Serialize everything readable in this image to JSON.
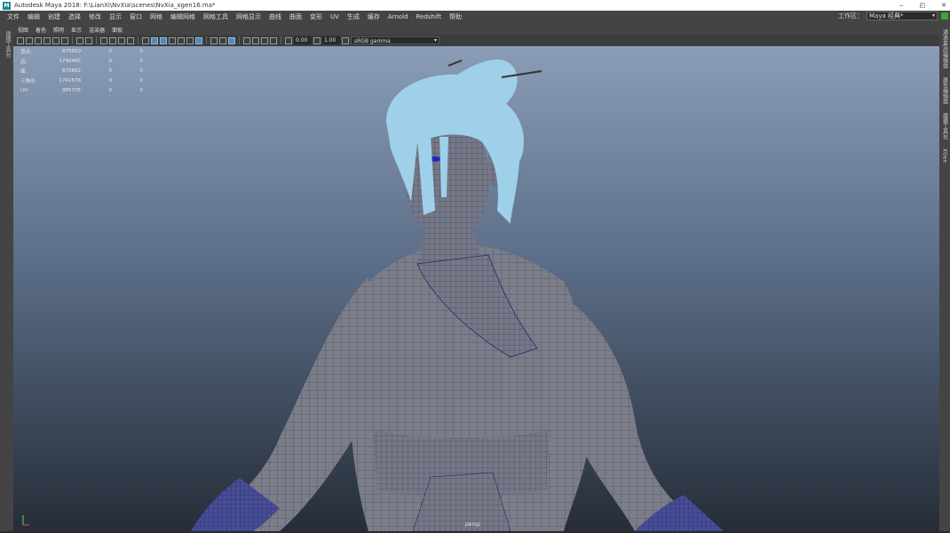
{
  "window": {
    "title": "Autodesk Maya 2018: F:\\LianXi\\NvXia\\scenes\\NvXia_xgen16.ma*",
    "app_icon": "M",
    "buttons": [
      "minimize-icon",
      "maximize-icon",
      "close-icon"
    ]
  },
  "menu": {
    "items": [
      "文件",
      "编辑",
      "创建",
      "选择",
      "修改",
      "显示",
      "窗口",
      "网格",
      "编辑网格",
      "网格工具",
      "网格显示",
      "曲线",
      "曲面",
      "变形",
      "UV",
      "生成",
      "缓存",
      "Arnold",
      "Redshift",
      "帮助"
    ],
    "workspace_label": "工作区：",
    "workspace_value": "Maya 经典*"
  },
  "left_strip": {
    "label": "建模工具包"
  },
  "right_strip": {
    "tabs": [
      "通道盒/层编辑器",
      "属性编辑器",
      "建模工具包",
      "XGen"
    ]
  },
  "panel_menu": {
    "items": [
      "视图",
      "着色",
      "照明",
      "显示",
      "渲染器",
      "面板"
    ]
  },
  "toolbar": {
    "exposure": "0.00",
    "gamma": "1.00",
    "color_space": "sRGB gamma"
  },
  "hud": {
    "rows": [
      {
        "label": "顶点:",
        "v1": "875650",
        "v2": "0",
        "v3": "0"
      },
      {
        "label": "边:",
        "v1": "1746465",
        "v2": "0",
        "v3": "0"
      },
      {
        "label": "面:",
        "v1": "870862",
        "v2": "0",
        "v3": "0"
      },
      {
        "label": "三角形:",
        "v1": "1741678",
        "v2": "0",
        "v3": "0"
      },
      {
        "label": "UV:",
        "v1": "985705",
        "v2": "0",
        "v3": "0"
      }
    ]
  },
  "viewport": {
    "camera": "persp",
    "colors": {
      "hair": "#9fd0ea",
      "mesh": "#7b7e87",
      "wire": "#1e2aa8"
    }
  }
}
